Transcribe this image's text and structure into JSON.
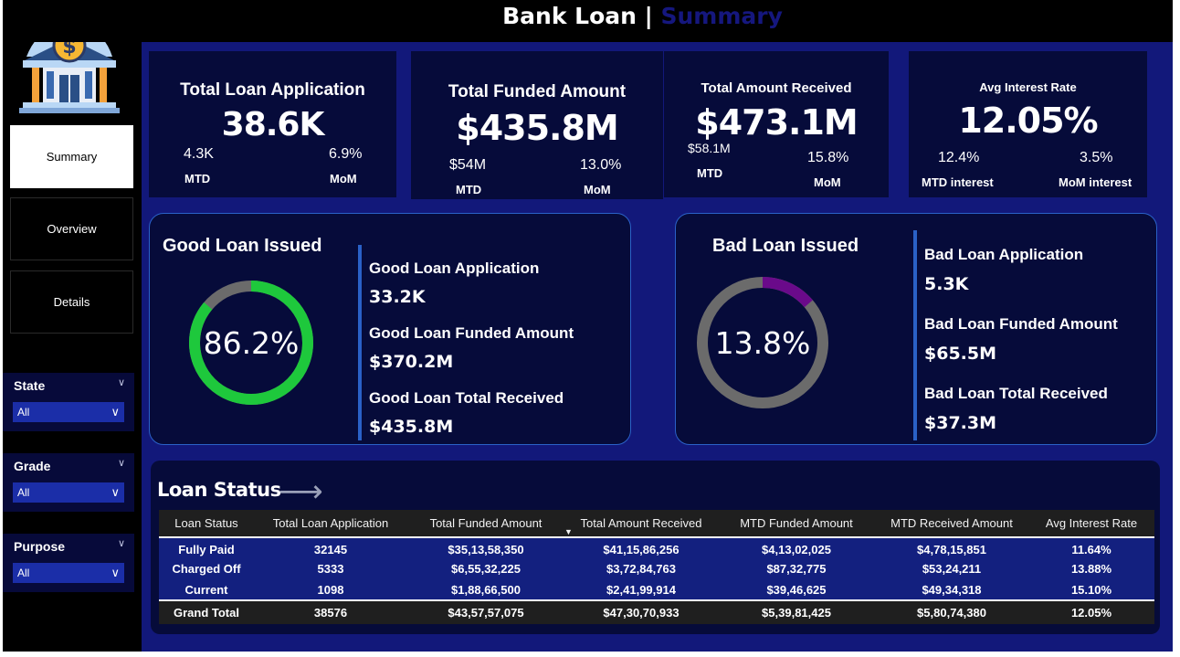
{
  "title": {
    "main": "Bank Loan",
    "separator": "|",
    "sub": "Summary"
  },
  "colors": {
    "background": "#12187a",
    "card": "#060b3a",
    "accent": "#2a61c7",
    "good": "#1ec83c",
    "bad": "#6a0a8a",
    "ring_track": "#6b6b6b",
    "title_sub": "#15177e"
  },
  "sidebar": {
    "logo_icon": "bank-dollar-icon",
    "nav": [
      {
        "label": "Summary",
        "active": true
      },
      {
        "label": "Overview",
        "active": false
      },
      {
        "label": "Details",
        "active": false
      }
    ],
    "filters": [
      {
        "label": "State",
        "value": "All"
      },
      {
        "label": "Grade",
        "value": "All"
      },
      {
        "label": "Purpose",
        "value": "All"
      }
    ]
  },
  "kpis": [
    {
      "title": "Total Loan Application",
      "value": "38.6K",
      "mtd_value": "4.3K",
      "mtd_label": "MTD",
      "mom_value": "6.9%",
      "mom_label": "MoM"
    },
    {
      "title": "Total Funded Amount",
      "value": "$435.8M",
      "mtd_value": "$54M",
      "mtd_label": "MTD",
      "mom_value": "13.0%",
      "mom_label": "MoM"
    },
    {
      "title": "Total Amount Received",
      "value": "$473.1M",
      "mtd_value": "$58.1M",
      "mtd_label": "MTD",
      "mom_value": "15.8%",
      "mom_label": "MoM"
    },
    {
      "title": "Avg Interest Rate",
      "value": "12.05%",
      "mtd_value": "12.4%",
      "mtd_label": "MTD interest",
      "mom_value": "3.5%",
      "mom_label": "MoM interest"
    }
  ],
  "good_loan": {
    "title": "Good Loan Issued",
    "percent_label": "86.2%",
    "percent": 0.862,
    "metrics": [
      {
        "label": "Good Loan Application",
        "value": "33.2K"
      },
      {
        "label": "Good Loan Funded Amount",
        "value": "$370.2M"
      },
      {
        "label": "Good Loan Total Received",
        "value": "$435.8M"
      }
    ]
  },
  "bad_loan": {
    "title": "Bad Loan Issued",
    "percent_label": "13.8%",
    "percent": 0.138,
    "metrics": [
      {
        "label": "Bad Loan Application",
        "value": "5.3K"
      },
      {
        "label": "Bad Loan Funded Amount",
        "value": "$65.5M"
      },
      {
        "label": "Bad Loan Total Received",
        "value": "$37.3M"
      }
    ]
  },
  "loan_status": {
    "title": "Loan Status",
    "arrow_icon": "arrow-right-icon",
    "columns": [
      "Loan Status",
      "Total Loan Application",
      "Total Funded Amount",
      "Total Amount Received",
      "MTD Funded Amount",
      "MTD Received Amount",
      "Avg Interest Rate"
    ],
    "sorted_column": "Total Amount Received",
    "rows": [
      [
        "Fully Paid",
        "32145",
        "$35,13,58,350",
        "$41,15,86,256",
        "$4,13,02,025",
        "$4,78,15,851",
        "11.64%"
      ],
      [
        "Charged Off",
        "5333",
        "$6,55,32,225",
        "$3,72,84,763",
        "$87,32,775",
        "$53,24,211",
        "13.88%"
      ],
      [
        "Current",
        "1098",
        "$1,88,66,500",
        "$2,41,99,914",
        "$39,46,625",
        "$49,34,318",
        "15.10%"
      ]
    ],
    "total": [
      "Grand Total",
      "38576",
      "$43,57,57,075",
      "$47,30,70,933",
      "$5,39,81,425",
      "$5,80,74,380",
      "12.05%"
    ]
  }
}
